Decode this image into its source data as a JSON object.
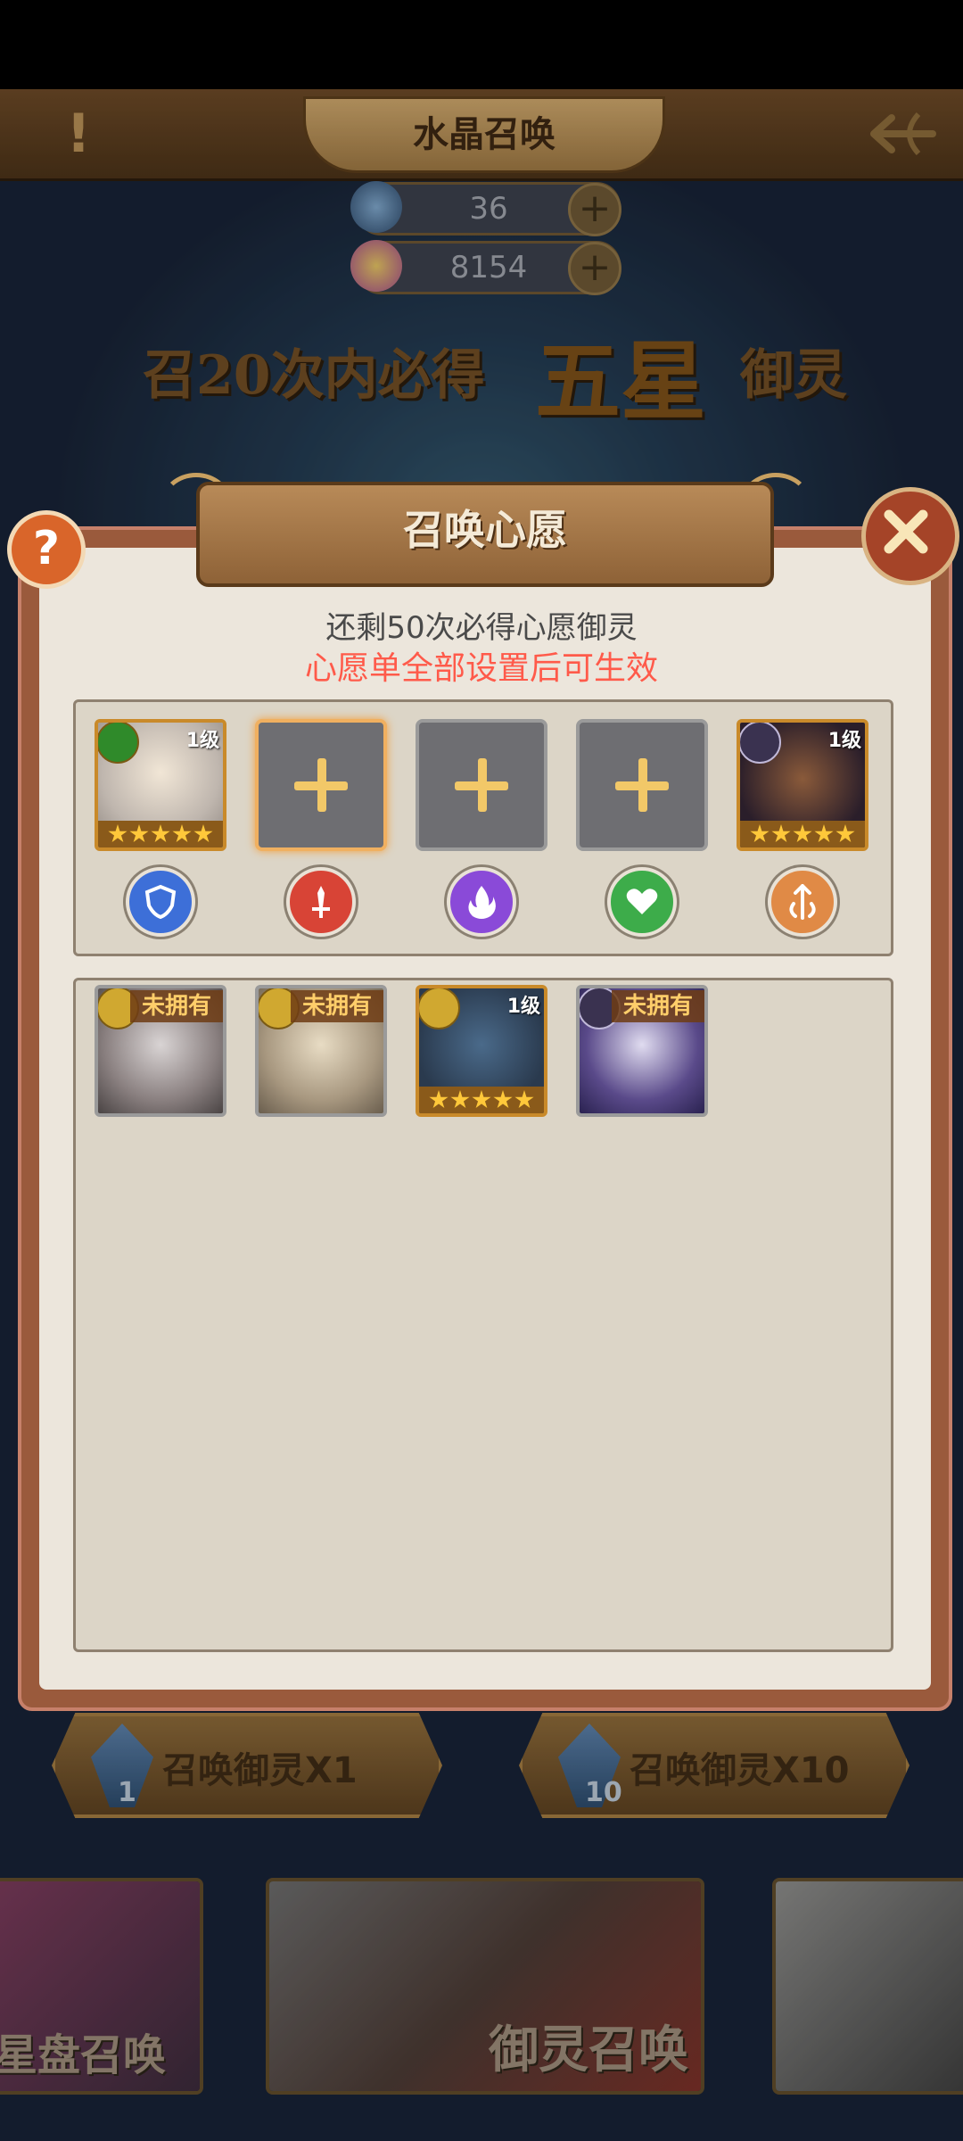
{
  "header": {
    "title": "水晶召唤",
    "alert_symbol": "!"
  },
  "currencies": [
    {
      "icon": "crystal-icon",
      "value": "36"
    },
    {
      "icon": "rainbow-gem-icon",
      "value": "8154"
    }
  ],
  "guarantee": {
    "part1": "召20次内必得",
    "part2": "五星",
    "part3": "御灵"
  },
  "dialog": {
    "title": "召唤心愿",
    "help_symbol": "?",
    "info_line1": "还剩50次必得心愿御灵",
    "info_line2": "心愿单全部设置后可生效",
    "wish_slots": [
      {
        "type": "hero",
        "level": "1级",
        "faction": "green",
        "stars": 5
      },
      {
        "type": "empty",
        "active": true
      },
      {
        "type": "empty",
        "active": false
      },
      {
        "type": "empty",
        "active": false
      },
      {
        "type": "hero",
        "level": "1级",
        "faction": "dark",
        "stars": 5
      }
    ],
    "class_icons": [
      "shield-icon",
      "sword-icon",
      "flame-icon",
      "heart-icon",
      "arrow-icon"
    ],
    "class_colors": [
      "#3d6fd8",
      "#d84436",
      "#8a4ad8",
      "#3dac4a",
      "#e08a46"
    ],
    "pool": [
      {
        "tag": "未拥有",
        "faction": "gold"
      },
      {
        "tag": "未拥有",
        "faction": "gold"
      },
      {
        "level": "1级",
        "faction": "gold",
        "stars": 5
      },
      {
        "tag": "未拥有",
        "faction": "dark"
      }
    ]
  },
  "summon_buttons": [
    {
      "label": "召唤御灵X1",
      "cost": "1"
    },
    {
      "label": "召唤御灵X10",
      "cost": "10"
    }
  ],
  "bottom_tabs": [
    {
      "label": "星盘召唤"
    },
    {
      "label": "御灵召唤"
    },
    {
      "label": ""
    }
  ],
  "colors": {
    "accent_red": "#ff5a4a",
    "gold_border": "#c98a2a",
    "modal_frame": "#9a5a3c"
  }
}
